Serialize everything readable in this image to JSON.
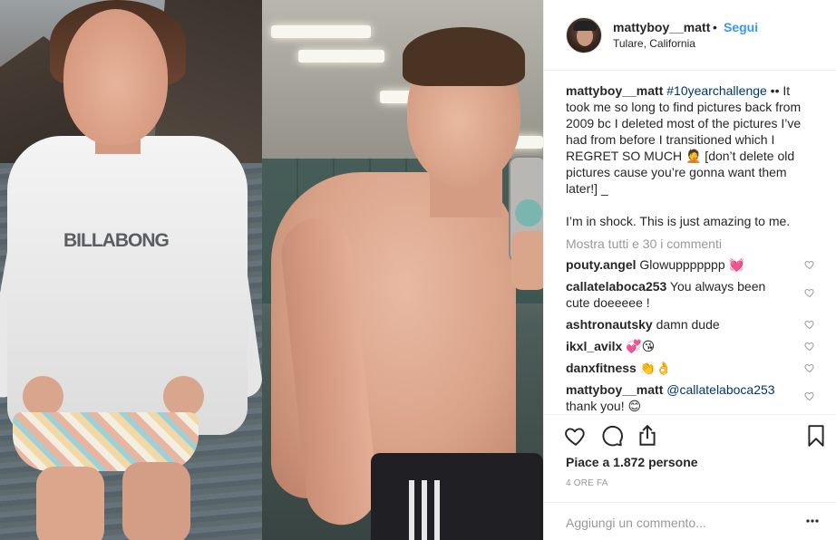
{
  "header": {
    "username": "mattyboy__matt",
    "separator": "•",
    "follow_label": "Segui",
    "location": "Tulare, California"
  },
  "photo": {
    "left_logo_text": "BILLABONG"
  },
  "caption": {
    "username": "mattyboy__matt",
    "hashtag": "#10yearchallenge",
    "text_1": " •• It took me so long to find pictures back from 2009 bc I deleted most of the pictures I’ve had from before I transitioned which I REGRET SO MUCH ",
    "emoji_1": "🤦",
    "text_2": " [don’t delete old pictures cause you’re gonna want them later!] _",
    "text_3": "I’m in shock. This is just amazing to me."
  },
  "view_all_label": "Mostra tutti e 30 i commenti",
  "comments": [
    {
      "user": "pouty.angel",
      "text": " Glowuppppppp ",
      "emoji": "💓"
    },
    {
      "user": "callatelaboca253",
      "text": " You always been cute doeeeee !",
      "emoji": ""
    },
    {
      "user": "ashtronautsky",
      "text": " damn dude",
      "emoji": ""
    },
    {
      "user": "ikxl_avilx",
      "text": " ",
      "emoji": "💞😘"
    },
    {
      "user": "danxfitness",
      "text": " ",
      "emoji": "👏👌"
    },
    {
      "user": "mattyboy__matt",
      "mention": "@callatelaboca253",
      "text": " thank you! ",
      "emoji": "😊"
    }
  ],
  "likes_label": "Piace a 1.872 persone",
  "timestamp": "4 ORE FA",
  "add_comment_placeholder": "Aggiungi un commento...",
  "colors": {
    "link_blue": "#3897f0",
    "hashtag_blue": "#003569",
    "muted_gray": "#999999",
    "heart_pink": "#ff3d8b"
  },
  "icons": [
    "heart-icon",
    "comment-icon",
    "share-icon",
    "bookmark-icon",
    "more-options-icon",
    "comment-heart-icon"
  ]
}
